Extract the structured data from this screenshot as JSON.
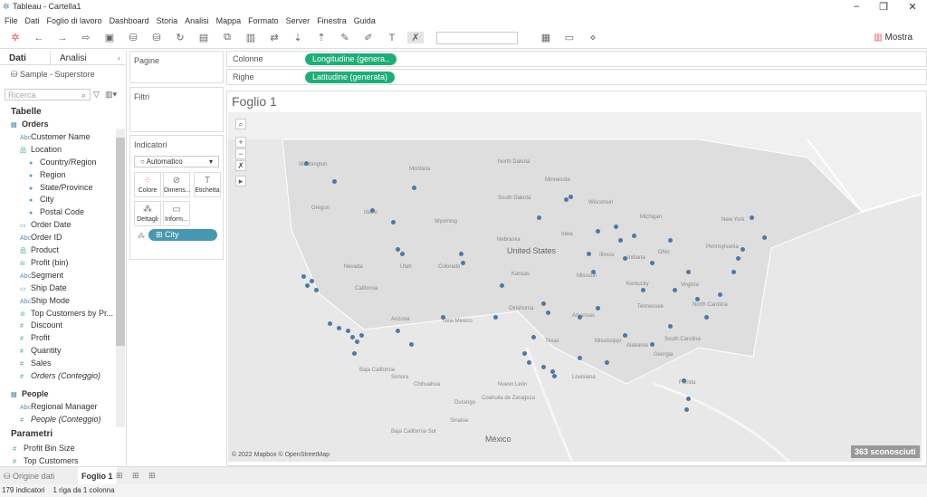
{
  "window": {
    "title": "Tableau - Cartella1",
    "minimize": "–",
    "maximize": "❐",
    "close": "✕"
  },
  "menu": [
    "File",
    "Dati",
    "Foglio di lavoro",
    "Dashboard",
    "Storia",
    "Analisi",
    "Mappa",
    "Formato",
    "Server",
    "Finestra",
    "Guida"
  ],
  "toolbar": {
    "show_me": "Mostra"
  },
  "left": {
    "tab_data": "Dati",
    "tab_analytics": "Analisi",
    "collapse": "‹",
    "datasource": "Sample - Superstore",
    "search_placeholder": "Ricerca",
    "tables_header": "Tabelle",
    "fields": [
      {
        "icon": "table",
        "label": "Orders",
        "bold": true
      },
      {
        "icon": "Abc",
        "label": "Customer Name"
      },
      {
        "icon": "hierarchy",
        "label": "Location"
      },
      {
        "icon": "geo",
        "label": "Country/Region"
      },
      {
        "icon": "geo",
        "label": "Region"
      },
      {
        "icon": "geo",
        "label": "State/Province"
      },
      {
        "icon": "geo",
        "label": "City"
      },
      {
        "icon": "geo",
        "label": "Postal Code"
      },
      {
        "icon": "date",
        "label": "Order Date"
      },
      {
        "icon": "Abc",
        "label": "Order ID"
      },
      {
        "icon": "hierarchy",
        "label": "Product"
      },
      {
        "icon": "bin",
        "label": "Profit (bin)"
      },
      {
        "icon": "Abc",
        "label": "Segment"
      },
      {
        "icon": "date",
        "label": "Ship Date"
      },
      {
        "icon": "Abc",
        "label": "Ship Mode"
      },
      {
        "icon": "set",
        "label": "Top Customers by Pr..."
      },
      {
        "icon": "#",
        "label": "Discount"
      },
      {
        "icon": "#",
        "label": "Profit"
      },
      {
        "icon": "#",
        "label": "Quantity"
      },
      {
        "icon": "#",
        "label": "Sales"
      },
      {
        "icon": "#",
        "label": "Orders (Conteggio)",
        "italic": true
      },
      {
        "icon": "table",
        "label": "People",
        "bold": true
      },
      {
        "icon": "Abc",
        "label": "Regional Manager"
      },
      {
        "icon": "#",
        "label": "People (Conteggio)",
        "italic": true
      }
    ],
    "params_header": "Parametri",
    "params": [
      "Profit Bin Size",
      "Top Customers"
    ]
  },
  "cards": {
    "pages": "Pagine",
    "filters": "Filtri",
    "marks": "Indicatori",
    "mark_type": "Automatico",
    "color": "Colore",
    "size": "Dimens...",
    "label": "Etichetta",
    "detail": "Dettagli",
    "tooltip": "Inform...",
    "detail_pill": "City"
  },
  "shelves": {
    "columns_label": "Colonne",
    "columns_pill": "Longitudine (genera..",
    "rows_label": "Righe",
    "rows_pill": "Latitudine (generata)"
  },
  "sheet": {
    "title": "Foglio 1",
    "attribution": "© 2022 Mapbox © OpenStreetMap",
    "unknown": "363 sconosciuti"
  },
  "map_labels": [
    "Washington",
    "Montana",
    "North Dakota",
    "South Dakota",
    "Minnesota",
    "Wisconsin",
    "Michigan",
    "Oregon",
    "Idaho",
    "Wyoming",
    "Nebraska",
    "Iowa",
    "Illinois",
    "Indiana",
    "Ohio",
    "Pennsylvania",
    "New York",
    "Nevada",
    "Utah",
    "Colorado",
    "Kansas",
    "Missouri",
    "Kentucky",
    "Virginia",
    "California",
    "Arizona",
    "New Mexico",
    "Oklahoma",
    "Arkansas",
    "Tennessee",
    "North Carolina",
    "South Carolina",
    "Texas",
    "Louisiana",
    "Mississippi",
    "Alabama",
    "Georgia",
    "Florida",
    "United States",
    "Sonora",
    "Chihuahua",
    "Coahuila de Zaragoza",
    "Nuevo León",
    "Baja California Sur",
    "Sinaloa",
    "Durango",
    "México",
    "Baja California"
  ],
  "chart_data": {
    "type": "scatter",
    "mark": "circle",
    "color": "#4e79a7",
    "xlabel": "Longitudine (generata)",
    "ylabel": "Latitudine (generata)",
    "points": [
      [
        -122.3,
        47.6
      ],
      [
        -119.1,
        46.0
      ],
      [
        -122.6,
        37.6
      ],
      [
        -121.6,
        37.2
      ],
      [
        -121.1,
        36.4
      ],
      [
        -122.1,
        36.8
      ],
      [
        -119.6,
        33.4
      ],
      [
        -118.6,
        33.0
      ],
      [
        -117.6,
        32.8
      ],
      [
        -117.1,
        32.2
      ],
      [
        -116.6,
        31.8
      ],
      [
        -116.1,
        32.4
      ],
      [
        -116.9,
        30.8
      ],
      [
        -112.1,
        32.8
      ],
      [
        -110.6,
        31.6
      ],
      [
        -112.1,
        40.0
      ],
      [
        -111.6,
        39.6
      ],
      [
        -114.9,
        43.4
      ],
      [
        -112.6,
        42.4
      ],
      [
        -110.3,
        45.4
      ],
      [
        -105.1,
        39.6
      ],
      [
        -104.9,
        38.8
      ],
      [
        -107.1,
        34.0
      ],
      [
        -101.3,
        34.0
      ],
      [
        -100.6,
        36.8
      ],
      [
        -98.1,
        30.8
      ],
      [
        -97.6,
        30.0
      ],
      [
        -95.0,
        29.2
      ],
      [
        -96.0,
        29.6
      ],
      [
        -94.8,
        28.8
      ],
      [
        -97.1,
        32.2
      ],
      [
        -96.0,
        35.2
      ],
      [
        -95.5,
        34.4
      ],
      [
        -92.0,
        34.0
      ],
      [
        -90.0,
        34.8
      ],
      [
        -88.0,
        42.0
      ],
      [
        -87.5,
        40.8
      ],
      [
        -87.0,
        39.2
      ],
      [
        -93.5,
        44.4
      ],
      [
        -93.0,
        44.6
      ],
      [
        -90.0,
        41.6
      ],
      [
        -86.0,
        41.2
      ],
      [
        -84.0,
        38.8
      ],
      [
        -82.0,
        40.8
      ],
      [
        -81.5,
        36.4
      ],
      [
        -80.0,
        38.0
      ],
      [
        -79.0,
        35.6
      ],
      [
        -78.0,
        34.0
      ],
      [
        -76.5,
        36.0
      ],
      [
        -75.0,
        38.0
      ],
      [
        -74.5,
        39.2
      ],
      [
        -74.0,
        40.0
      ],
      [
        -71.5,
        41.0
      ],
      [
        -73.0,
        42.8
      ],
      [
        -82.0,
        33.2
      ],
      [
        -84.0,
        31.6
      ],
      [
        -80.5,
        28.4
      ],
      [
        -80.0,
        26.8
      ],
      [
        -80.2,
        25.8
      ],
      [
        -87.0,
        32.4
      ],
      [
        -89.0,
        30.0
      ],
      [
        -92.0,
        30.4
      ],
      [
        -96.5,
        42.8
      ],
      [
        -90.5,
        38.0
      ],
      [
        -85.0,
        36.4
      ],
      [
        -91.0,
        39.6
      ]
    ]
  },
  "bottom": {
    "datasource_tab": "Origine dati",
    "sheet_tab": "Foglio 1"
  },
  "status": {
    "marks": "179 indicatori",
    "rows": "1 riga da 1 colonna"
  }
}
